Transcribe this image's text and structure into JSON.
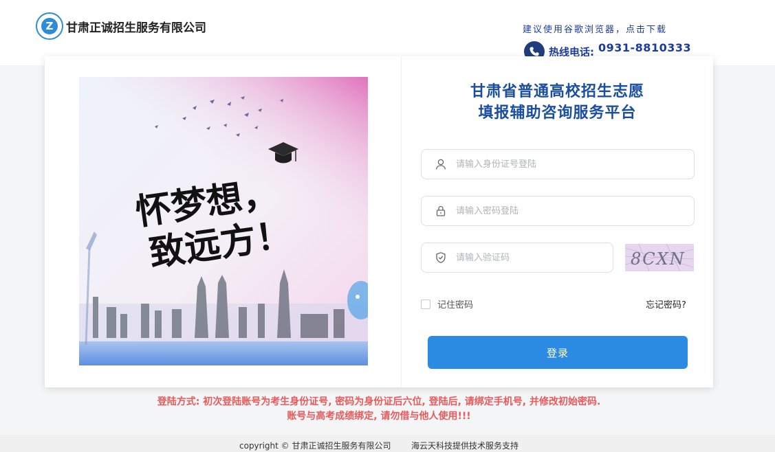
{
  "header": {
    "company_name": "甘肃正诚招生服务有限公司",
    "logo_letter": "Z",
    "browser_tip": "建议使用谷歌浏览器，点击下载",
    "hotline_label": "热线电话:",
    "hotline_number": "0931-8810333"
  },
  "poster": {
    "slogan_line1": "怀梦想，",
    "slogan_line2": "致远方！"
  },
  "login": {
    "title_line1": "甘肃省普通高校招生志愿",
    "title_line2": "填报辅助咨询服务平台",
    "id_placeholder": "请输入身份证号登陆",
    "password_placeholder": "请输入密码登陆",
    "captcha_placeholder": "请输入验证码",
    "captcha_text": "8CXN",
    "remember_label": "记住密码",
    "forgot_label": "忘记密码?",
    "submit_label": "登录"
  },
  "notice": {
    "line1": "登陆方式: 初次登陆账号为考生身份证号, 密码为身份证后六位, 登陆后, 请绑定手机号, 并修改初始密码.",
    "line2": "账号与高考成绩绑定, 请勿借与他人使用!!!"
  },
  "footer": {
    "copyright": "copyright © 甘肃正诚招生服务有限公司",
    "tech_support": "海云天科技提供技术服务支持"
  },
  "colors": {
    "title": "#1a4fa0",
    "button": "#2b8be3",
    "notice": "#e85a5a",
    "tip": "#1c3ba0"
  }
}
